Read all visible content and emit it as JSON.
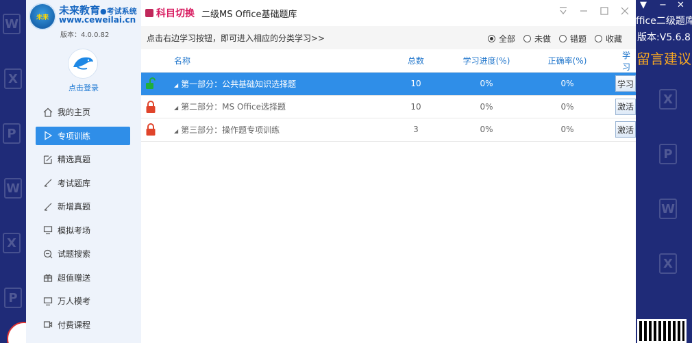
{
  "background_app": {
    "title_fragment": "ffice二级题库",
    "version": "版本:V5.6.8",
    "suggestion": "留言建议"
  },
  "sidebar": {
    "brand": "未来教育",
    "brand_sub": "●考试系统",
    "site": "www.ceweilai.cn",
    "version": "版本：4.0.0.82",
    "login": "点击登录",
    "items": [
      {
        "label": "我的主页",
        "icon": "home-icon"
      },
      {
        "label": "专项训练",
        "icon": "play-icon",
        "active": true
      },
      {
        "label": "精选真题",
        "icon": "edit-icon"
      },
      {
        "label": "考试题库",
        "icon": "pen-icon"
      },
      {
        "label": "新增真题",
        "icon": "pen-icon"
      },
      {
        "label": "模拟考场",
        "icon": "monitor-icon"
      },
      {
        "label": "试题搜索",
        "icon": "search-icon"
      },
      {
        "label": "超值赠送",
        "icon": "gift-icon"
      },
      {
        "label": "万人模考",
        "icon": "monitor-icon"
      },
      {
        "label": "付费课程",
        "icon": "video-icon"
      }
    ]
  },
  "titlebar": {
    "switch_label": "科目切换",
    "bank_name": "二级MS Office基础题库"
  },
  "hint": "点击右边学习按钮，即可进入相应的分类学习>>",
  "filters": [
    {
      "label": "全部",
      "checked": true
    },
    {
      "label": "未做",
      "checked": false
    },
    {
      "label": "错题",
      "checked": false
    },
    {
      "label": "收藏",
      "checked": false
    }
  ],
  "table": {
    "headers": {
      "name": "名称",
      "total": "总数",
      "progress": "学习进度(%)",
      "accuracy": "正确率(%)",
      "action": "学习"
    },
    "rows": [
      {
        "name": "第一部分：公共基础知识选择题",
        "total": "10",
        "progress": "0%",
        "accuracy": "0%",
        "action": "学习",
        "locked": false,
        "selected": true
      },
      {
        "name": "第二部分：MS Office选择题",
        "total": "10",
        "progress": "0%",
        "accuracy": "0%",
        "action": "激活",
        "locked": true,
        "selected": false
      },
      {
        "name": "第三部分：操作题专项训练",
        "total": "3",
        "progress": "0%",
        "accuracy": "0%",
        "action": "激活",
        "locked": true,
        "selected": false
      }
    ]
  },
  "colors": {
    "accent": "#2f8ee8",
    "switch": "#d81b60",
    "lock_red": "#e0442b",
    "lock_green": "#1fae3a"
  }
}
